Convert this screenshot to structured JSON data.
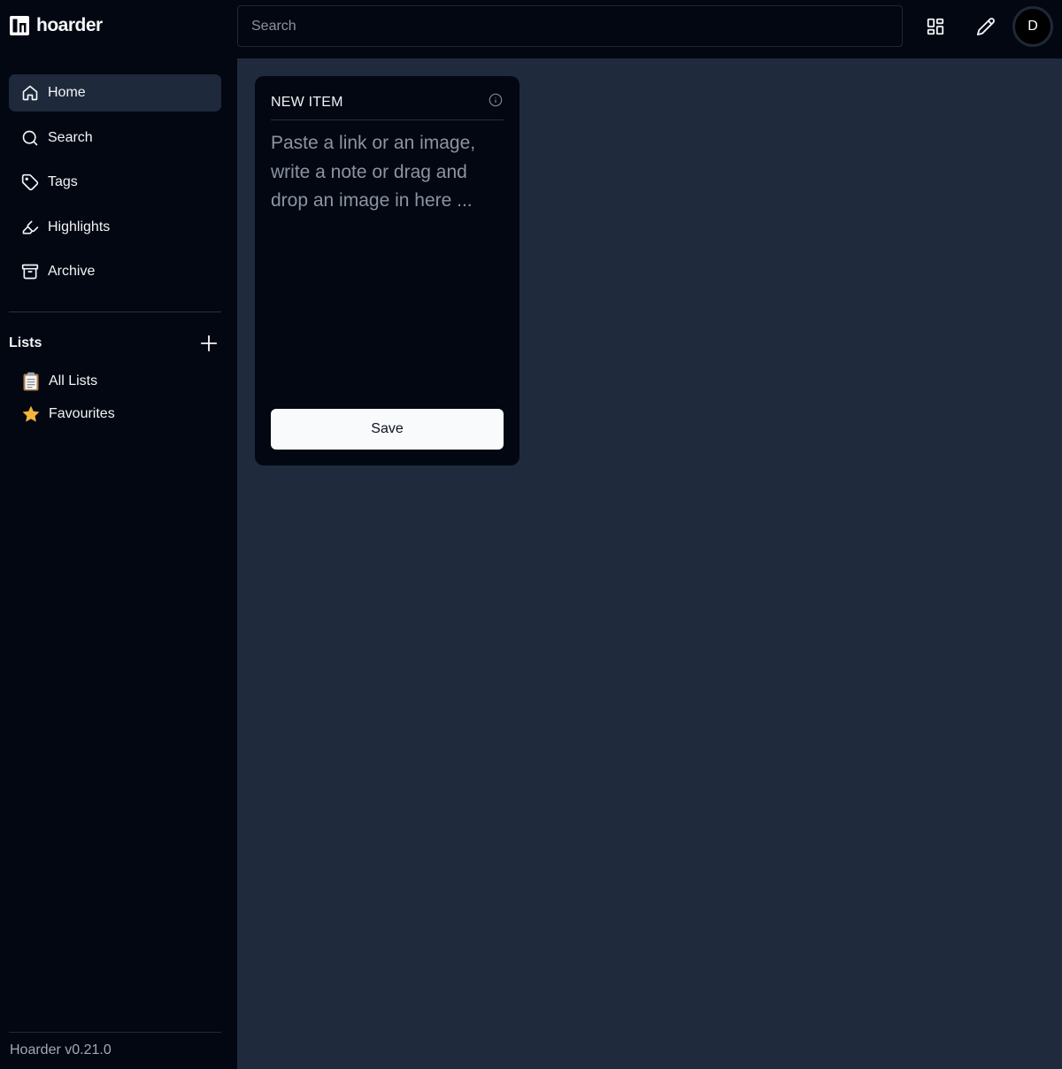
{
  "app": {
    "name": "hoarder",
    "version": "Hoarder v0.21.0"
  },
  "sidebar": {
    "nav": [
      {
        "label": "Home",
        "icon": "home-icon",
        "active": true
      },
      {
        "label": "Search",
        "icon": "search-icon",
        "active": false
      },
      {
        "label": "Tags",
        "icon": "tag-icon",
        "active": false
      },
      {
        "label": "Highlights",
        "icon": "highlighter-icon",
        "active": false
      },
      {
        "label": "Archive",
        "icon": "archive-icon",
        "active": false
      }
    ],
    "lists_title": "Lists",
    "lists": [
      {
        "label": "All Lists",
        "icon": "clipboard-emoji"
      },
      {
        "label": "Favourites",
        "icon": "star-emoji"
      }
    ]
  },
  "header": {
    "search_placeholder": "Search",
    "avatar_initial": "D"
  },
  "editor_card": {
    "title": "NEW ITEM",
    "placeholder": "Paste a link or an image, write a note or drag and drop an image in here ...",
    "save_label": "Save"
  },
  "colors": {
    "sidebar_bg": "#030711",
    "main_bg": "#1f2a3d",
    "active_nav_bg": "#1e293b",
    "star": "#f4b43c"
  }
}
